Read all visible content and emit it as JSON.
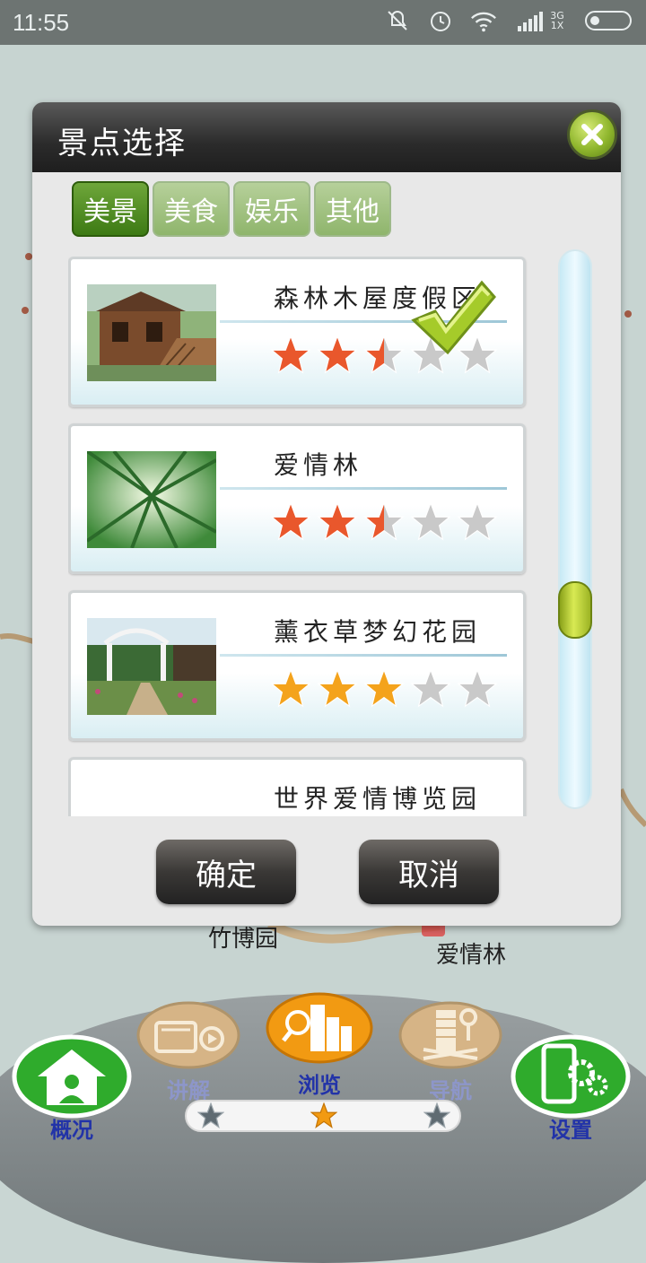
{
  "status_bar": {
    "time": "11:55",
    "signal_text_top": "3G",
    "signal_text_bottom": "1X",
    "icons": [
      "mute-icon",
      "alarm-icon",
      "wifi-icon",
      "signal-icon",
      "battery-icon"
    ]
  },
  "map_labels": {
    "bamboo_expo": "竹博园",
    "love_forest": "爱情林"
  },
  "dialog": {
    "title": "景点选择",
    "tabs": [
      {
        "label": "美景",
        "active": true
      },
      {
        "label": "美食",
        "active": false
      },
      {
        "label": "娱乐",
        "active": false
      },
      {
        "label": "其他",
        "active": false
      }
    ],
    "items": [
      {
        "name": "森林木屋度假区",
        "rating": 2.5,
        "max": 5,
        "star_color": "#e9572c",
        "selected": true,
        "image": "wooden-cabin-photo"
      },
      {
        "name": "爱情林",
        "rating": 2.5,
        "max": 5,
        "star_color": "#e9572c",
        "selected": false,
        "image": "bamboo-forest-photo"
      },
      {
        "name": "薰衣草梦幻花园",
        "rating": 3,
        "max": 5,
        "star_color": "#f4a31c",
        "selected": false,
        "image": "garden-gazebo-photo"
      },
      {
        "name": "世界爱情博览园",
        "rating": null,
        "max": 5,
        "star_color": "#e9572c",
        "selected": false,
        "image": "blank-photo"
      }
    ],
    "scroll_position": 0.6,
    "confirm_label": "确定",
    "cancel_label": "取消"
  },
  "bottom_nav": {
    "items": [
      {
        "label": "概况",
        "icon": "home-user-icon"
      },
      {
        "label": "讲解",
        "icon": "audio-guide-icon"
      },
      {
        "label": "浏览",
        "icon": "city-search-icon"
      },
      {
        "label": "导航",
        "icon": "navigation-building-icon"
      },
      {
        "label": "设置",
        "icon": "phone-settings-icon"
      }
    ],
    "active": "浏览",
    "pager_active_index": 1,
    "colors": {
      "label_blue": "#2233a8",
      "active_orange": "#f29a12",
      "green_button": "#2fab2c"
    }
  }
}
